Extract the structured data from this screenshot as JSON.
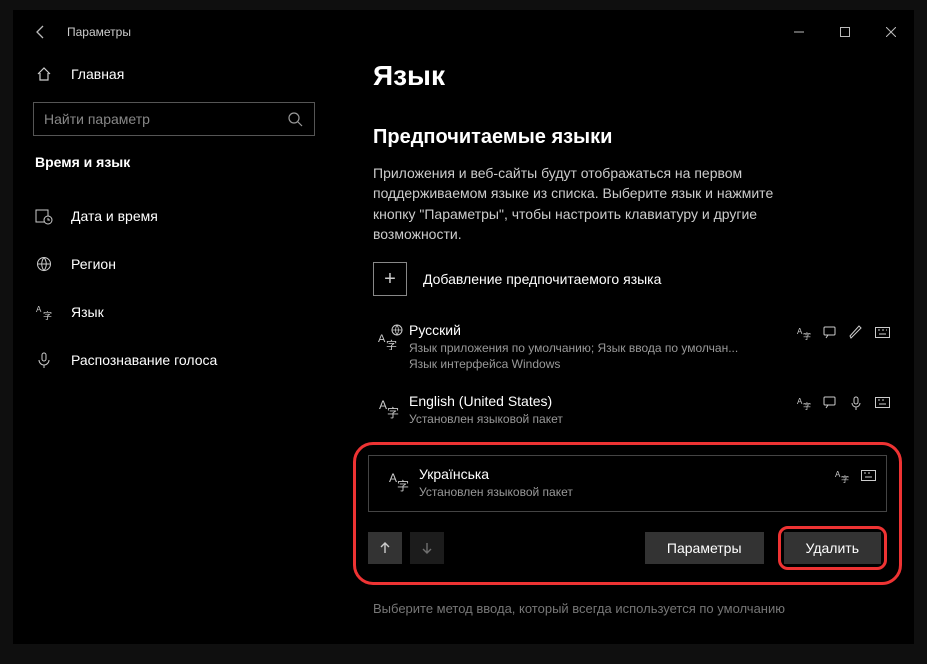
{
  "titlebar": {
    "title": "Параметры"
  },
  "sidebar": {
    "home": "Главная",
    "search_placeholder": "Найти параметр",
    "category": "Время и язык",
    "items": [
      {
        "label": "Дата и время"
      },
      {
        "label": "Регион"
      },
      {
        "label": "Язык"
      },
      {
        "label": "Распознавание голоса"
      }
    ]
  },
  "main": {
    "h1": "Язык",
    "h2": "Предпочитаемые языки",
    "desc": "Приложения и веб-сайты будут отображаться на первом поддерживаемом языке из списка. Выберите язык и нажмите кнопку \"Параметры\", чтобы настроить клавиатуру и другие возможности.",
    "add_label": "Добавление предпочитаемого языка",
    "langs": [
      {
        "name": "Русский",
        "sub": "Язык приложения по умолчанию; Язык ввода по умолчан...",
        "sub2": "Язык интерфейса Windows",
        "features": [
          "a-lang",
          "tts",
          "hand",
          "kbd"
        ]
      },
      {
        "name": "English (United States)",
        "sub": "Установлен языковой пакет",
        "features": [
          "a-lang",
          "tts",
          "mic",
          "kbd"
        ]
      },
      {
        "name": "Українська",
        "sub": "Установлен языковой пакет",
        "features": [
          "a-lang",
          "kbd"
        ]
      }
    ],
    "btn_params": "Параметры",
    "btn_delete": "Удалить",
    "hint": "Выберите метод ввода, который всегда используется по умолчанию"
  }
}
